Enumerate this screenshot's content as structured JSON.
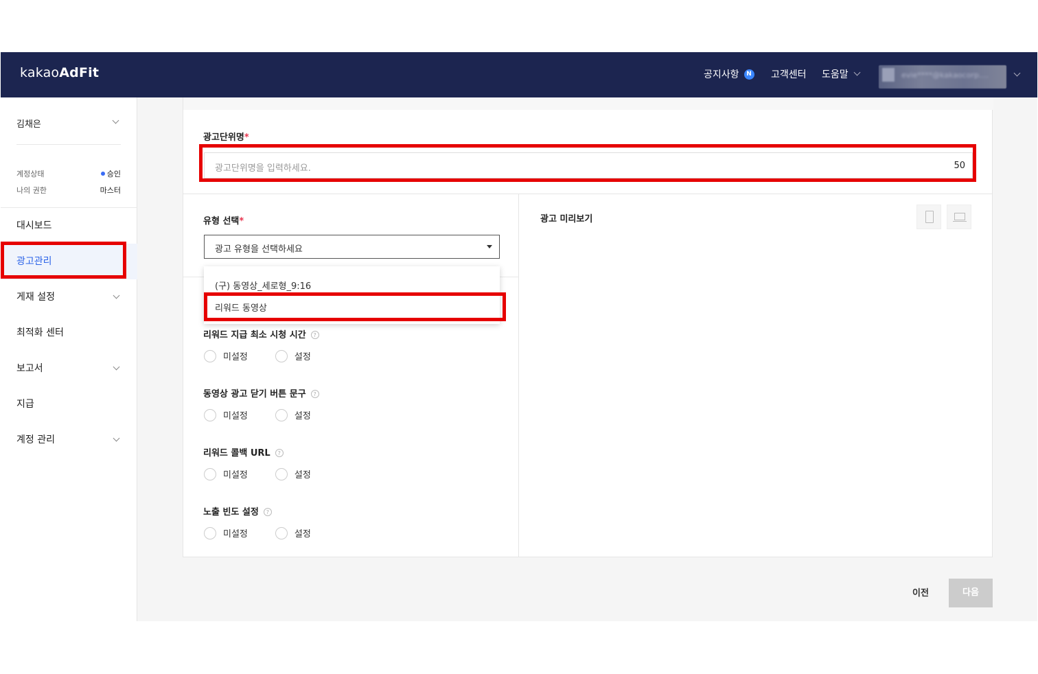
{
  "header": {
    "logo_light": "kakao",
    "logo_bold": "AdFit",
    "notice": "공지사항",
    "notice_badge": "N",
    "support": "고객센터",
    "help": "도움말",
    "account_blurred": "evie****@kakaocorp...."
  },
  "sidebar": {
    "user_name": "김채은",
    "account_status_label": "계정상태",
    "account_status_value": "승인",
    "permission_label": "나의 권한",
    "permission_value": "마스터",
    "menu": [
      {
        "label": "대시보드"
      },
      {
        "label": "광고관리"
      },
      {
        "label": "게재 설정"
      },
      {
        "label": "최적화 센터"
      },
      {
        "label": "보고서"
      },
      {
        "label": "지급"
      },
      {
        "label": "계정 관리"
      }
    ]
  },
  "form": {
    "ad_unit_name_label": "광고단위명",
    "required_mark": "*",
    "ad_unit_name_placeholder": "광고단위명을 입력하세요.",
    "ad_unit_name_counter": "50",
    "type_label": "유형 선택",
    "type_select_value": "광고 유형을 선택하세요",
    "type_options": [
      "(구) 동영상_세로형_9:16",
      "리워드 동영상"
    ],
    "help_glyph": "?",
    "settings": [
      {
        "label": "리워드 지급 최소 시청 시간"
      },
      {
        "label": "동영상 광고 닫기 버튼 문구"
      },
      {
        "label": "리워드 콜백 URL"
      },
      {
        "label": "노출 빈도 설정"
      }
    ],
    "radio_unset": "미설정",
    "radio_set": "설정"
  },
  "preview": {
    "title": "광고 미리보기"
  },
  "footer": {
    "prev": "이전",
    "next": "다음"
  },
  "colors": {
    "header_bg": "#1c2550",
    "active_menu": "#2b63e8",
    "highlight": "#e60000",
    "disabled_button": "#cccccc"
  }
}
